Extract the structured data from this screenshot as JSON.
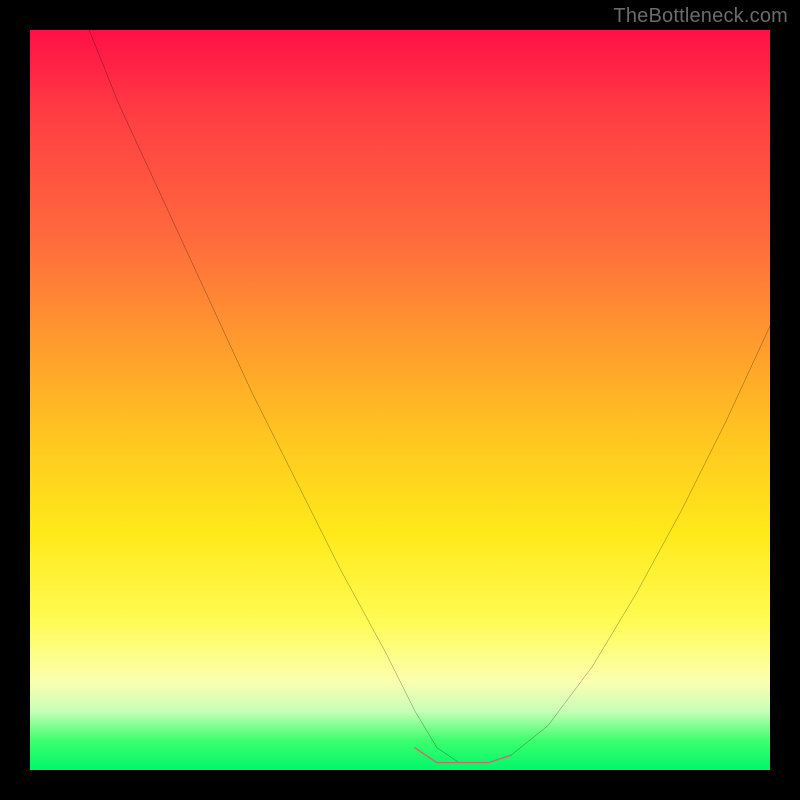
{
  "watermark": "TheBottleneck.com",
  "chart_data": {
    "type": "line",
    "title": "",
    "xlabel": "",
    "ylabel": "",
    "xlim": [
      0,
      100
    ],
    "ylim": [
      0,
      100
    ],
    "series": [
      {
        "name": "bottleneck-curve",
        "x": [
          8,
          12,
          18,
          24,
          30,
          36,
          42,
          48,
          52,
          55,
          58,
          62,
          65,
          70,
          76,
          82,
          88,
          94,
          100
        ],
        "values": [
          100,
          90,
          77,
          64,
          51,
          39,
          27,
          16,
          8,
          3,
          1,
          1,
          2,
          6,
          14,
          24,
          35,
          47,
          60
        ]
      },
      {
        "name": "optimal-band",
        "x": [
          52,
          55,
          58,
          62,
          65
        ],
        "values": [
          3,
          1,
          1,
          1,
          2
        ]
      }
    ],
    "colors": {
      "curve": "#000000",
      "optimal_band": "#cc6d6d",
      "gradient_top": "#ff1046",
      "gradient_mid": "#ffe91a",
      "gradient_bottom": "#00f76b"
    }
  }
}
